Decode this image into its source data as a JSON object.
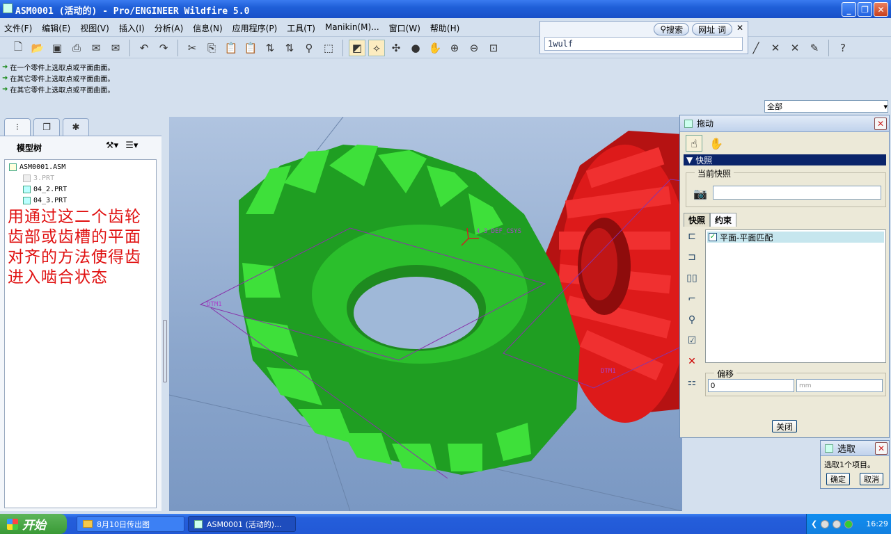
{
  "window": {
    "title": "ASM0001 (活动的) - Pro/ENGINEER Wildfire 5.0",
    "min": "_",
    "max": "❐",
    "close": "✕"
  },
  "menu": [
    "文件(F)",
    "编辑(E)",
    "视图(V)",
    "插入(I)",
    "分析(A)",
    "信息(N)",
    "应用程序(P)",
    "工具(T)",
    "Manikin(M)...",
    "窗口(W)",
    "帮助(H)"
  ],
  "search_popup": {
    "tab_search": "搜索",
    "tab_url": "网址",
    "tab_word": "词",
    "value": "1wulf"
  },
  "messages": [
    "在一个零件上选取点或平面曲面。",
    "在其它零件上选取点或平面曲面。",
    "在其它零件上选取点或平面曲面。"
  ],
  "filter": {
    "value": "全部"
  },
  "model_tree": {
    "header": "模型树",
    "items": [
      {
        "label": "ASM0001.ASM",
        "state": "root"
      },
      {
        "label": "3.PRT",
        "state": "dim"
      },
      {
        "label": "04_2.PRT",
        "state": "normal"
      },
      {
        "label": "04_3.PRT",
        "state": "normal"
      }
    ]
  },
  "annotation": "用通过这二个齿轮齿部或齿槽的平面对齐的方法使得齿进入啮合状态",
  "viewport": {
    "labels": {
      "csys": "4_3_DEF_CSYS",
      "dtm_left": "DTM1",
      "dtm_right": "DTM1"
    },
    "colors": {
      "gear_green": "#2ecc40",
      "gear_red": "#dd1a1a",
      "datum": "#8833aa"
    }
  },
  "drag_dialog": {
    "title": "拖动",
    "section": "快照",
    "current_snapshot_label": "当前快照",
    "snapshot_name": "",
    "tabs": [
      "快照",
      "约束"
    ],
    "active_tab": "约束",
    "constraints": [
      {
        "label": "平面-平面匹配",
        "checked": true
      }
    ],
    "offset_label": "偏移",
    "offset_value": "0",
    "offset_unit": "mm",
    "close": "关闭"
  },
  "select_dialog": {
    "title": "选取",
    "message": "选取1个项目。",
    "ok": "确定",
    "cancel": "取消"
  },
  "taskbar": {
    "start": "开始",
    "tasks": [
      "8月10日传出图",
      "ASM0001 (活动的)..."
    ],
    "clock": "16:29"
  }
}
